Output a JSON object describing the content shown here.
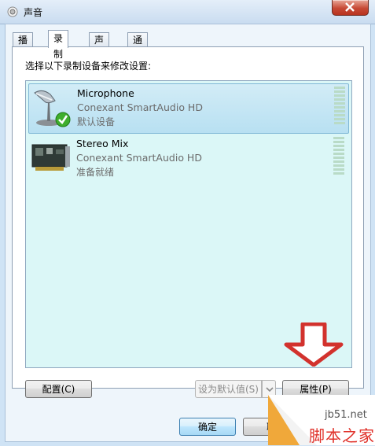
{
  "window": {
    "title": "声音"
  },
  "tabs": [
    {
      "label": "播放"
    },
    {
      "label": "录制"
    },
    {
      "label": "声音"
    },
    {
      "label": "通信"
    }
  ],
  "panel": {
    "instruction": "选择以下录制设备来修改设置:"
  },
  "devices": [
    {
      "name": "Microphone",
      "driver": "Conexant SmartAudio HD",
      "status": "默认设备",
      "icon": "microphone-icon",
      "selected": true
    },
    {
      "name": "Stereo Mix",
      "driver": "Conexant SmartAudio HD",
      "status": "准备就绪",
      "icon": "sound-card-icon",
      "selected": false
    }
  ],
  "buttons": {
    "configure": "配置(C)",
    "set_default": "设为默认值(S)",
    "properties": "属性(P)",
    "ok": "确定",
    "cancel": "取"
  },
  "watermark": {
    "site": "jb51.net",
    "name": "脚本之家"
  },
  "colors": {
    "list_bg": "#dbf7f7",
    "selected_bg": "#bfe4f4",
    "arrow": "#d2322d",
    "close": "#c74a36"
  }
}
